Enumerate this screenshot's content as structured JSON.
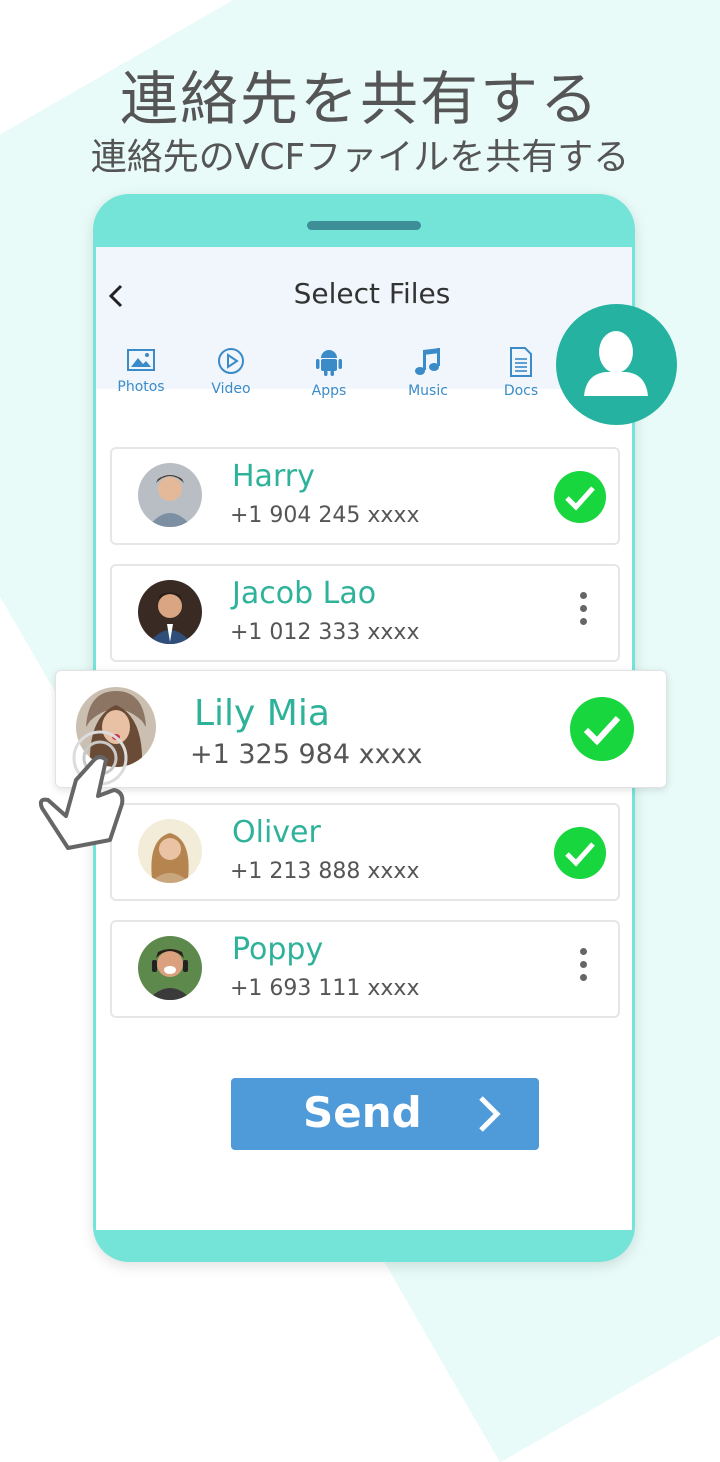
{
  "promo": {
    "headline": "連絡先を共有する",
    "subheadline": "連絡先のVCFファイルを共有する"
  },
  "header": {
    "back_icon": "chevron-left-icon",
    "title": "Select Files"
  },
  "tabs": [
    {
      "label": "Photos",
      "icon": "image-icon"
    },
    {
      "label": "Video",
      "icon": "play-circle-icon"
    },
    {
      "label": "Apps",
      "icon": "android-icon"
    },
    {
      "label": "Music",
      "icon": "music-note-icon"
    },
    {
      "label": "Docs",
      "icon": "document-icon"
    }
  ],
  "contacts": [
    {
      "name": "Harry",
      "phone": "+1 904 245 xxxx",
      "selected": true
    },
    {
      "name": "Jacob Lao",
      "phone": "+1 012 333 xxxx",
      "selected": false
    },
    {
      "name": "Lily Mia",
      "phone": "+1 325 984 xxxx",
      "selected": true
    },
    {
      "name": "Oliver",
      "phone": "+1 213 888 xxxx",
      "selected": true
    },
    {
      "name": "Poppy",
      "phone": "+1 693 111 xxxx",
      "selected": false
    }
  ],
  "send_button": {
    "label": "Send"
  },
  "colors": {
    "accent_teal": "#2eb29a",
    "phone_frame": "#74e4d8",
    "check_green": "#17d63e",
    "send_blue": "#4f9ad8",
    "tab_blue": "#3a8bc8"
  }
}
